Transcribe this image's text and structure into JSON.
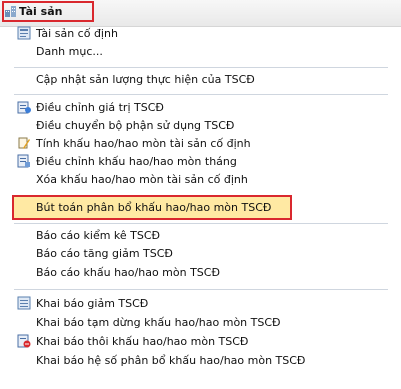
{
  "header": {
    "title": "Tài sản",
    "icon": "assets-icon"
  },
  "groups": [
    {
      "items": [
        {
          "label": "Tài sản cố định",
          "icon": "fixed-asset-icon"
        },
        {
          "label": "Danh mục..."
        }
      ]
    },
    {
      "items": [
        {
          "label": "Cập nhật sản lượng thực hiện của TSCĐ"
        }
      ]
    },
    {
      "items": [
        {
          "label": "Điều chỉnh giá trị TSCĐ",
          "icon": "adjust-value-icon"
        },
        {
          "label": "Điều chuyển bộ phận sử dụng TSCĐ"
        },
        {
          "label": "Tính khấu hao/hao mòn tài sản cố định",
          "icon": "calculate-depreciation-icon"
        },
        {
          "label": "Điều chỉnh khấu hao/hao mòn tháng",
          "icon": "adjust-depreciation-icon"
        },
        {
          "label": "Xóa khấu hao/hao mòn tài sản cố định"
        },
        {
          "label": "Bút toán phân bổ khấu hao/hao mòn TSCĐ",
          "selected": true
        }
      ]
    },
    {
      "items": [
        {
          "label": "Báo cáo kiểm kê TSCĐ"
        },
        {
          "label": "Báo cáo tăng giảm TSCĐ"
        },
        {
          "label": "Báo cáo khấu hao/hao mòn TSCĐ"
        }
      ]
    },
    {
      "items": [
        {
          "label": "Khai báo giảm TSCĐ",
          "icon": "decrease-asset-icon"
        },
        {
          "label": "Khai báo tạm dừng khấu hao/hao mòn TSCĐ"
        },
        {
          "label": "Khai báo thôi khấu hao/hao mòn TSCĐ",
          "icon": "stop-depreciation-icon"
        },
        {
          "label": "Khai báo hệ số phân bổ khấu hao/hao mòn TSCĐ"
        }
      ]
    }
  ],
  "colors": {
    "highlight_fill": "#ffe9a3",
    "highlight_border": "#d9282e",
    "separator": "#cfd6df"
  }
}
